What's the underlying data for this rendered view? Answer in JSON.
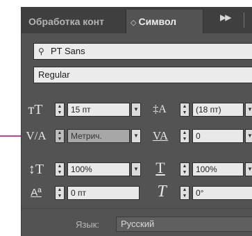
{
  "tabs": {
    "inactive": "Обработка конт",
    "active": "Символ",
    "overflow_icon": "double-chevron-right-icon"
  },
  "font": {
    "family": "PT Sans",
    "style": "Regular"
  },
  "character": {
    "size": "15 пт",
    "leading": "(18 пт)",
    "kerning": "Метрич.",
    "tracking": "0",
    "vertical_scale": "100%",
    "horizontal_scale": "100%",
    "baseline_shift": "0 пт",
    "skew": "0°"
  },
  "language": {
    "label": "Язык:",
    "value": "Русский"
  },
  "colors": {
    "panel": "#535353",
    "tab_bar": "#3f3f3f",
    "pointer": "#d63a8f"
  }
}
